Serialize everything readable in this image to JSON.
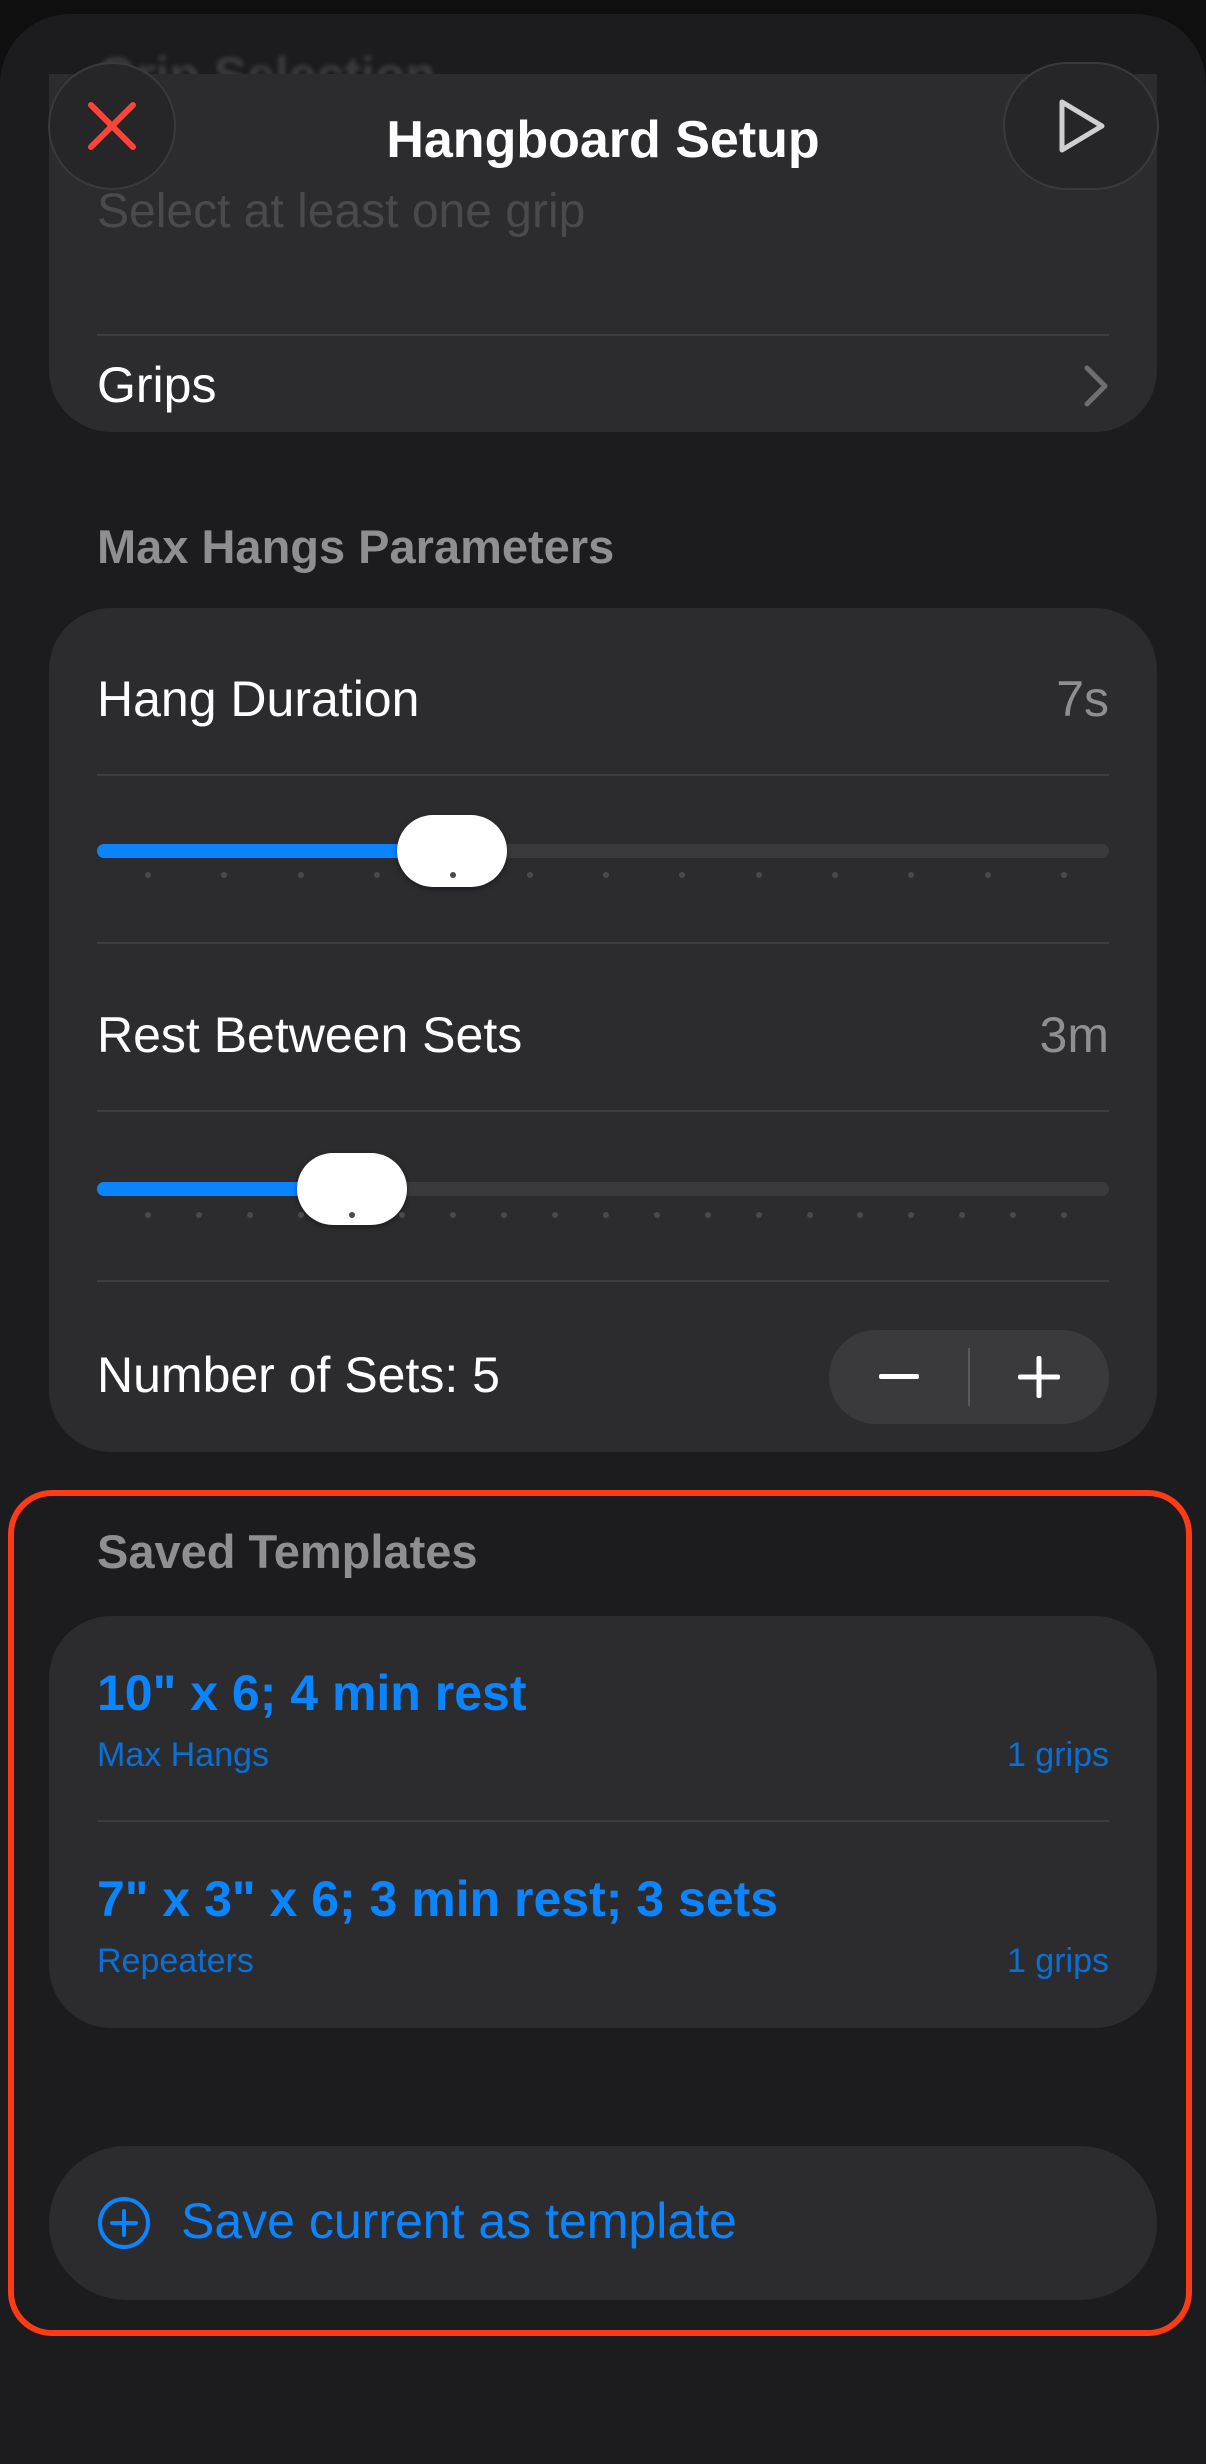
{
  "nav": {
    "title": "Hangboard Setup",
    "close_icon": "close-icon",
    "play_icon": "play-icon"
  },
  "grip_selection": {
    "header": "Grip Selection",
    "placeholder": "Select at least one grip",
    "grips_label": "Grips"
  },
  "parameters": {
    "header": "Max Hangs Parameters",
    "hang_duration": {
      "label": "Hang Duration",
      "value": "7s",
      "slider_fraction": 0.35
    },
    "rest_between_sets": {
      "label": "Rest Between Sets",
      "value": "3m",
      "slider_fraction": 0.25
    },
    "number_of_sets": {
      "label": "Number of Sets: 5"
    }
  },
  "templates": {
    "header": "Saved Templates",
    "items": [
      {
        "title": "10\" x 6; 4 min rest",
        "type": "Max Hangs",
        "count": "1 grips"
      },
      {
        "title": "7\" x 3\" x 6; 3 min rest; 3 sets",
        "type": "Repeaters",
        "count": "1 grips"
      }
    ],
    "save_label": "Save current as template"
  },
  "colors": {
    "accent": "#0a84ff",
    "close": "#ff453a",
    "highlight_border": "#ff3b16"
  }
}
